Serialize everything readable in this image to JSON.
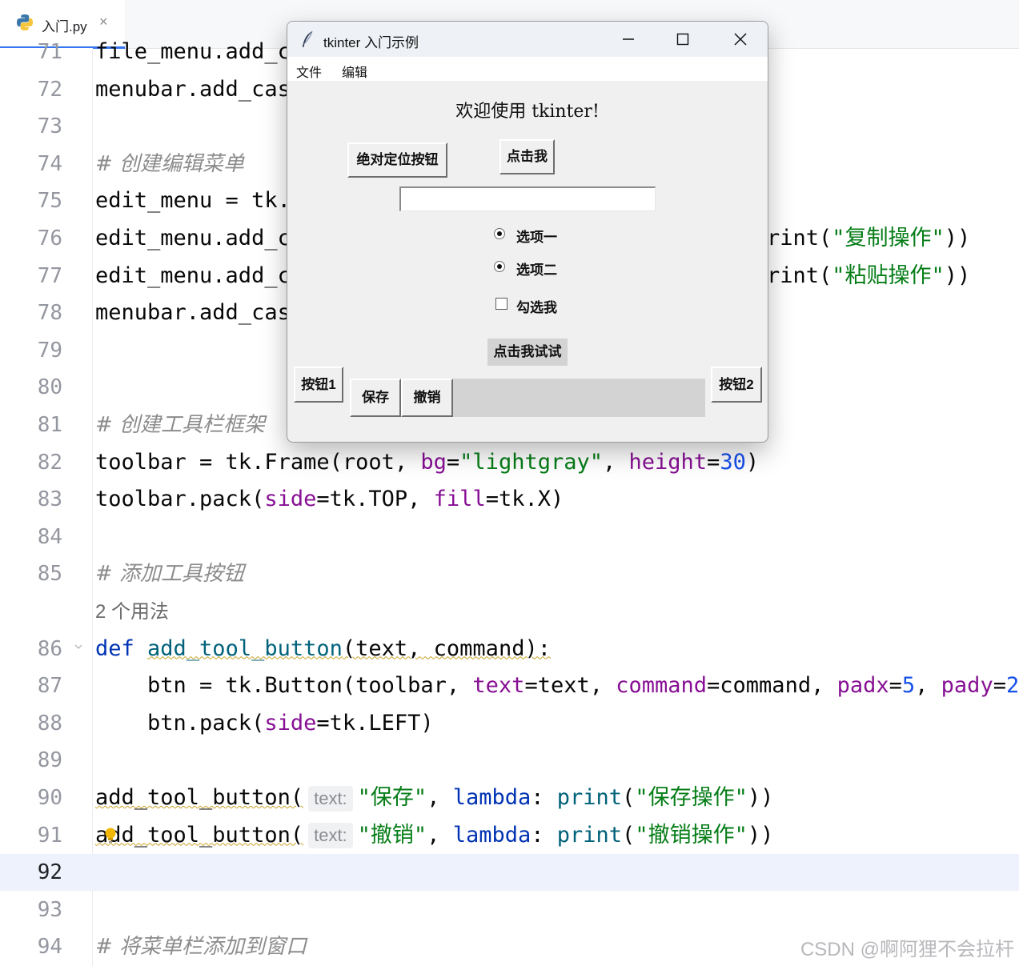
{
  "editor": {
    "tab": {
      "label": "入门.py",
      "close": "×"
    },
    "lines": [
      {
        "num": "71",
        "parts": [
          [
            "plain",
            "file_menu.add_c"
          ]
        ]
      },
      {
        "num": "72",
        "parts": [
          [
            "plain",
            "menubar.add_cas"
          ]
        ]
      },
      {
        "num": "73",
        "parts": []
      },
      {
        "num": "74",
        "parts": [
          [
            "comment",
            "# 创建编辑菜单"
          ]
        ]
      },
      {
        "num": "75",
        "parts": [
          [
            "plain",
            "edit_menu = tk."
          ]
        ]
      },
      {
        "num": "76",
        "parts": [
          [
            "plain",
            "edit_menu.add_c"
          ]
        ],
        "tail": [
          [
            "plain",
            "rint("
          ],
          [
            "str",
            "\"复制操作\""
          ],
          [
            "plain",
            "))"
          ]
        ]
      },
      {
        "num": "77",
        "parts": [
          [
            "plain",
            "edit_menu.add_c"
          ]
        ],
        "tail": [
          [
            "plain",
            "rint("
          ],
          [
            "str",
            "\"粘贴操作\""
          ],
          [
            "plain",
            "))"
          ]
        ]
      },
      {
        "num": "78",
        "parts": [
          [
            "plain",
            "menubar.add_cas"
          ]
        ]
      },
      {
        "num": "79",
        "parts": []
      },
      {
        "num": "80",
        "parts": []
      },
      {
        "num": "81",
        "parts": [
          [
            "comment",
            "# 创建工具栏框架"
          ]
        ]
      },
      {
        "num": "82",
        "parts": [
          [
            "plain",
            "toolbar = tk.Frame(root, "
          ],
          [
            "param",
            "bg"
          ],
          [
            "plain",
            "="
          ],
          [
            "str",
            "\"lightgray\""
          ],
          [
            "plain",
            ", "
          ],
          [
            "param",
            "height"
          ],
          [
            "plain",
            "="
          ],
          [
            "num",
            "30"
          ],
          [
            "plain",
            ")"
          ]
        ]
      },
      {
        "num": "83",
        "parts": [
          [
            "plain",
            "toolbar.pack("
          ],
          [
            "param",
            "side"
          ],
          [
            "plain",
            "=tk.TOP, "
          ],
          [
            "param",
            "fill"
          ],
          [
            "plain",
            "=tk.X)"
          ]
        ]
      },
      {
        "num": "84",
        "parts": []
      },
      {
        "num": "85",
        "parts": [
          [
            "comment",
            "# 添加工具按钮"
          ]
        ]
      },
      {
        "num": "",
        "parts": [
          [
            "usage",
            "2 个用法"
          ]
        ]
      },
      {
        "num": "86",
        "fold": true,
        "parts": [
          [
            "kw",
            "def "
          ],
          [
            "fnw",
            "add_tool_button"
          ],
          [
            "plainw",
            "(text, command):"
          ]
        ]
      },
      {
        "num": "87",
        "parts": [
          [
            "plain",
            "    btn = tk.Button(toolbar, "
          ],
          [
            "param",
            "text"
          ],
          [
            "plain",
            "=text, "
          ],
          [
            "param",
            "command"
          ],
          [
            "plain",
            "=command, "
          ],
          [
            "param",
            "padx"
          ],
          [
            "plain",
            "="
          ],
          [
            "num",
            "5"
          ],
          [
            "plain",
            ", "
          ],
          [
            "param",
            "pady"
          ],
          [
            "plain",
            "="
          ],
          [
            "num",
            "2"
          ],
          [
            "plain",
            ")"
          ]
        ]
      },
      {
        "num": "88",
        "parts": [
          [
            "plain",
            "    btn.pack("
          ],
          [
            "param",
            "side"
          ],
          [
            "plain",
            "=tk.LEFT)"
          ]
        ]
      },
      {
        "num": "89",
        "parts": []
      },
      {
        "num": "90",
        "parts": [
          [
            "plainw",
            "add_tool_button("
          ],
          [
            "hint",
            "text:"
          ],
          [
            "str",
            "\"保存\""
          ],
          [
            "plain",
            ", "
          ],
          [
            "kw",
            "lambda"
          ],
          [
            "plain",
            ": "
          ],
          [
            "fn",
            "print"
          ],
          [
            "plain",
            "("
          ],
          [
            "str",
            "\"保存操作\""
          ],
          [
            "plain",
            "))"
          ]
        ]
      },
      {
        "num": "91",
        "bulb": true,
        "parts": [
          [
            "plainw",
            "add_tool_button("
          ],
          [
            "hint",
            "text:"
          ],
          [
            "str",
            "\"撤销\""
          ],
          [
            "plain",
            ", "
          ],
          [
            "kw",
            "lambda"
          ],
          [
            "plain",
            ": "
          ],
          [
            "fn",
            "print"
          ],
          [
            "plain",
            "("
          ],
          [
            "str",
            "\"撤销操作\""
          ],
          [
            "plain",
            "))"
          ]
        ]
      },
      {
        "num": "92",
        "current": true,
        "parts": []
      },
      {
        "num": "93",
        "parts": []
      },
      {
        "num": "94",
        "parts": [
          [
            "comment",
            "# 将菜单栏添加到窗口"
          ]
        ]
      }
    ],
    "watermark": "CSDN @啊阿狸不会拉杆"
  },
  "tk_window": {
    "title": "tkinter 入门示例",
    "menu": [
      "文件",
      "编辑"
    ],
    "label": "欢迎使用 tkinter!",
    "abs_button": "绝对定位按钮",
    "click_button": "点击我",
    "entry_value": "",
    "radio1": "选项一",
    "radio2": "选项二",
    "checkbox": "勾选我",
    "try_button": "点击我试试",
    "button1": "按钮1",
    "button2": "按钮2",
    "save_button": "保存",
    "undo_button": "撤销"
  }
}
